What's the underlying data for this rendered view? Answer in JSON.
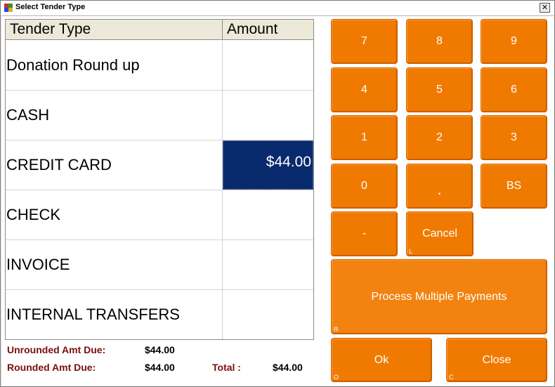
{
  "window": {
    "title": "Select Tender Type",
    "close_glyph": "✕"
  },
  "table": {
    "headers": {
      "type": "Tender Type",
      "amount": "Amount"
    },
    "rows": [
      {
        "type": "Donation Round up",
        "amount": ""
      },
      {
        "type": "CASH",
        "amount": ""
      },
      {
        "type": "CREDIT CARD",
        "amount": "$44.00",
        "selected": true
      },
      {
        "type": "CHECK",
        "amount": ""
      },
      {
        "type": "INVOICE",
        "amount": ""
      },
      {
        "type": "INTERNAL TRANSFERS",
        "amount": ""
      }
    ]
  },
  "totals": {
    "unrounded_label": "Unrounded Amt Due:",
    "unrounded_value": "$44.00",
    "rounded_label": "Rounded Amt Due:",
    "rounded_value": "$44.00",
    "total_label": "Total :",
    "total_value": "$44.00"
  },
  "keypad": {
    "k7": "7",
    "k8": "8",
    "k9": "9",
    "k4": "4",
    "k5": "5",
    "k6": "6",
    "k1": "1",
    "k2": "2",
    "k3": "3",
    "k0": "0",
    "kdot": ".",
    "kbs": "BS",
    "kminus": "-",
    "cancel": "Cancel",
    "cancel_hotkey": "L",
    "multi": "Process Multiple Payments",
    "multi_hotkey": "R",
    "ok": "Ok",
    "ok_hotkey": "O",
    "close": "Close",
    "close_hotkey": "C"
  },
  "colors": {
    "key_orange": "#f07a00",
    "selected_cell": "#0a2a6e",
    "label_red": "#7a0f0f"
  }
}
